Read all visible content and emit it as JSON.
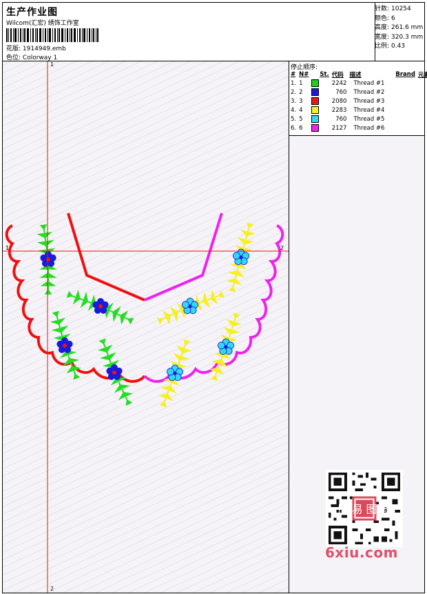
{
  "header": {
    "title": "生产作业图",
    "subtitle": "Wilcom(汇宏) 绣饰工作室",
    "design_label": "花版:",
    "design_value": "1914949.emb",
    "colorway_label": "色位:",
    "colorway_value": "Colorway 1"
  },
  "stats": [
    {
      "label": "针数:",
      "value": "10254"
    },
    {
      "label": "颜色:",
      "value": "6"
    },
    {
      "label": "高度:",
      "value": "261.6 mm"
    },
    {
      "label": "宽度:",
      "value": "320.3 mm"
    },
    {
      "label": "比例:",
      "value": "0.43"
    }
  ],
  "stop_sequence": {
    "title": "停止顺序:",
    "columns": [
      "#",
      "N#",
      "St.",
      "代码",
      "描述",
      "Brand",
      "元素"
    ],
    "rows": [
      {
        "n": "1.",
        "nn": "1",
        "color": "#22cc22",
        "code": "2242",
        "desc": "Thread #1"
      },
      {
        "n": "2.",
        "nn": "2",
        "color": "#1a1adc",
        "code": "760",
        "desc": "Thread #2"
      },
      {
        "n": "3.",
        "nn": "3",
        "color": "#e81818",
        "code": "2080",
        "desc": "Thread #3"
      },
      {
        "n": "4.",
        "nn": "4",
        "color": "#f5f020",
        "code": "2283",
        "desc": "Thread #4"
      },
      {
        "n": "5.",
        "nn": "5",
        "color": "#33d8ee",
        "code": "760",
        "desc": "Thread #5"
      },
      {
        "n": "6.",
        "nn": "6",
        "color": "#ee22ee",
        "code": "2127",
        "desc": "Thread #6"
      }
    ]
  },
  "axes": {
    "v_top": "1",
    "v_bottom": "2",
    "h_left": "1",
    "h_right": "2"
  },
  "watermark": {
    "brand": "6xiu.com",
    "stamp": "图 易 图 图"
  },
  "colors": {
    "red": "#ee1111",
    "magenta": "#ee22ee",
    "green": "#22dd22",
    "blue": "#1a1adc",
    "yellow": "#f5f020",
    "cyan": "#33d8ee"
  }
}
